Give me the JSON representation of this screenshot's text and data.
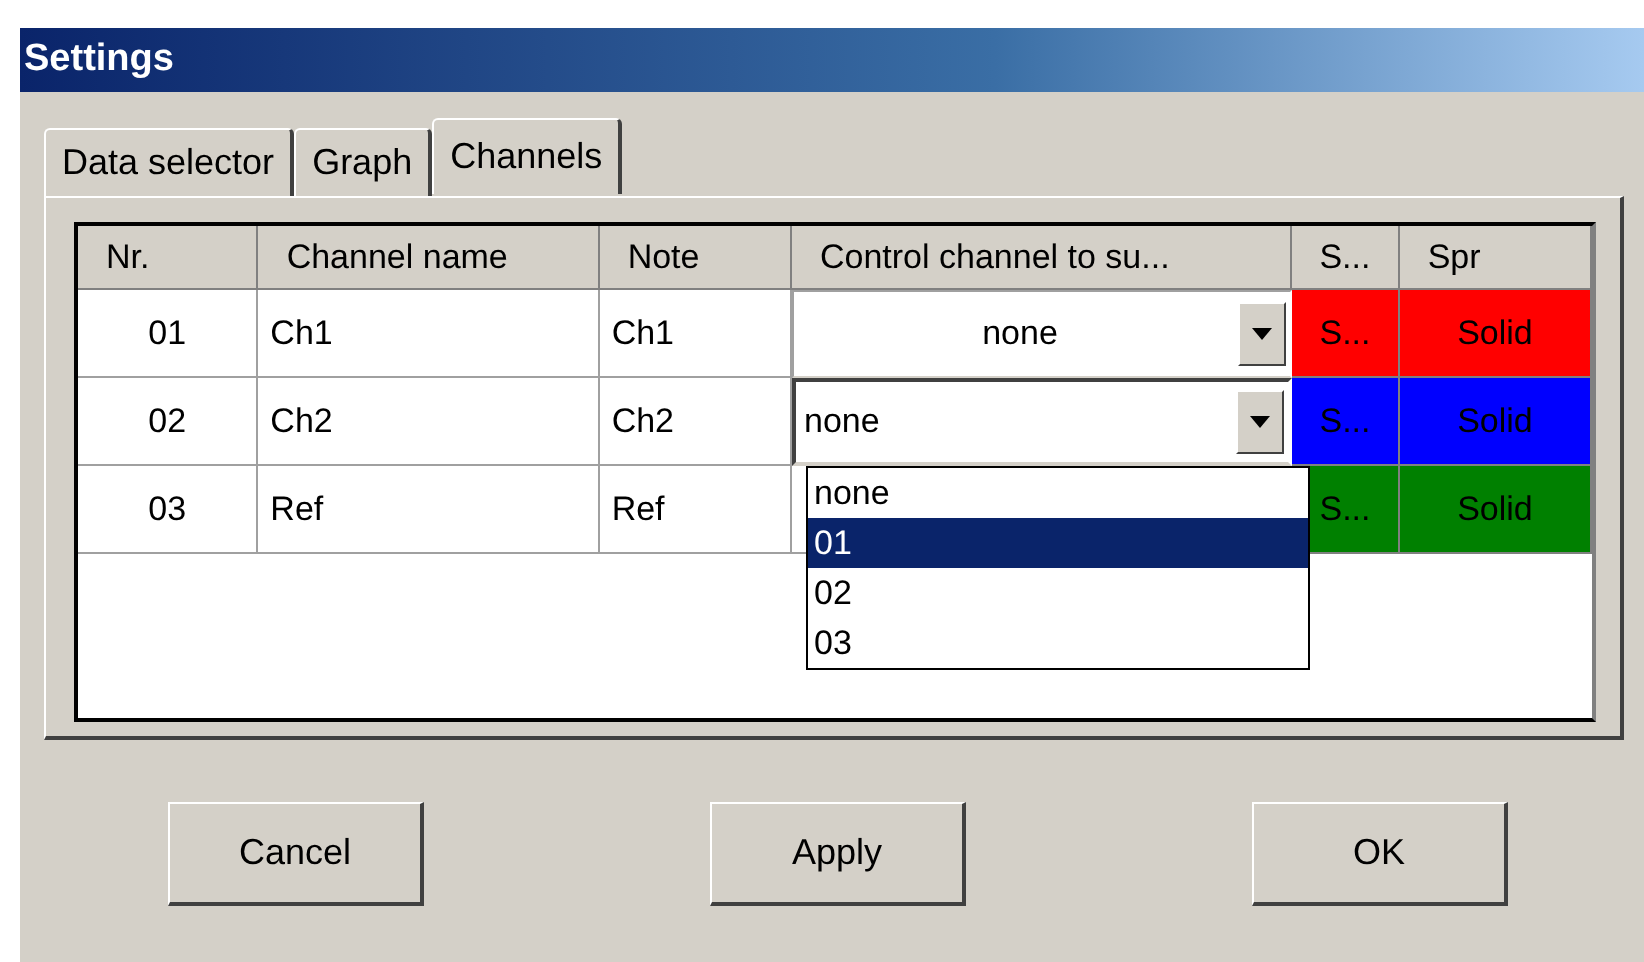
{
  "window": {
    "title": "Settings"
  },
  "tabs": [
    {
      "label": "Data selector",
      "selected": false
    },
    {
      "label": "Graph",
      "selected": false
    },
    {
      "label": "Channels",
      "selected": true
    }
  ],
  "table": {
    "columns": [
      "Nr.",
      "Channel name",
      "Note",
      "Control channel to su...",
      "S...",
      "Spr"
    ],
    "rows": [
      {
        "nr": "01",
        "name": "Ch1",
        "note": "Ch1",
        "control": {
          "value": "none",
          "focused": false
        },
        "color_label": "S...",
        "style": "Solid",
        "color": "#ff0000"
      },
      {
        "nr": "02",
        "name": "Ch2",
        "note": "Ch2",
        "control": {
          "value": "none",
          "focused": true
        },
        "color_label": "S...",
        "style": "Solid",
        "color": "#0000ff"
      },
      {
        "nr": "03",
        "name": "Ref",
        "note": "Ref",
        "color_label": "S...",
        "style": "Solid",
        "color": "#008000"
      }
    ]
  },
  "dropdown": {
    "options": [
      {
        "label": "none",
        "selected": false
      },
      {
        "label": "01",
        "selected": true
      },
      {
        "label": "02",
        "selected": false
      },
      {
        "label": "03",
        "selected": false
      }
    ]
  },
  "buttons": [
    "Cancel",
    "Apply",
    "OK"
  ]
}
